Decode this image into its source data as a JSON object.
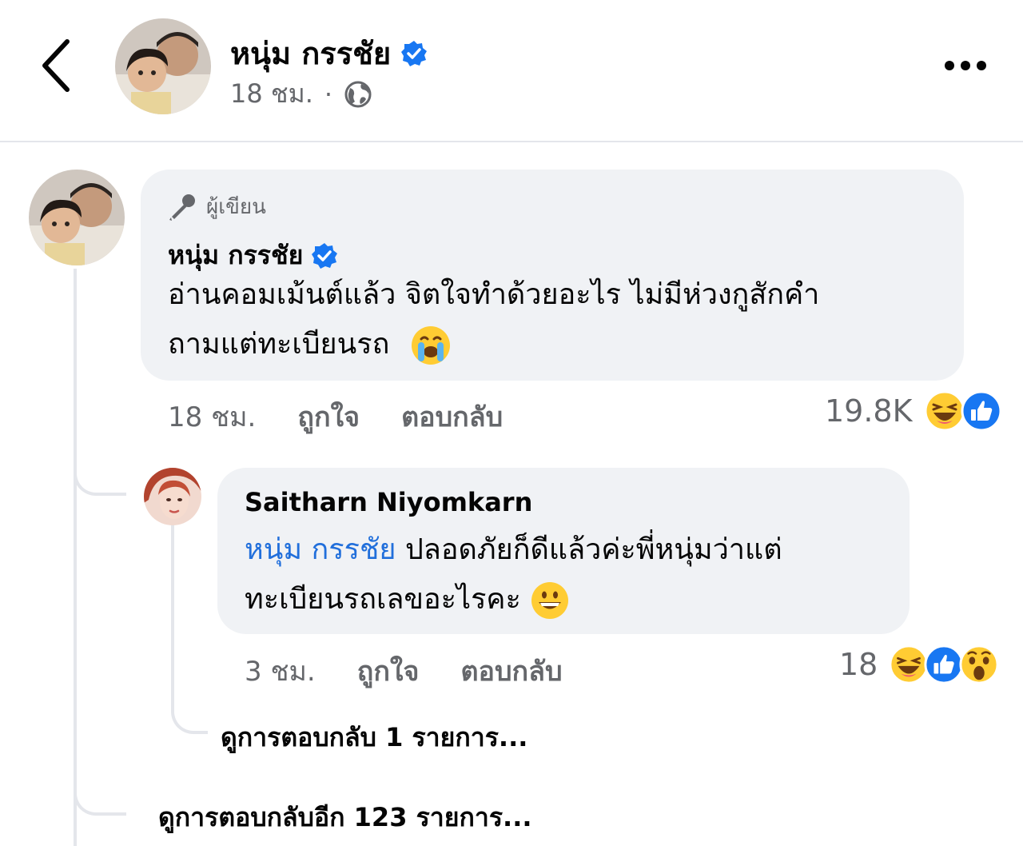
{
  "header": {
    "name": "หนุ่ม กรรชัย",
    "time": "18 ชม.",
    "separator": "·",
    "privacy_icon": "globe-icon",
    "back_icon": "chevron-left-icon",
    "more_icon": "more-horizontal-icon"
  },
  "main_comment": {
    "badge": "ผู้เขียน",
    "badge_icon": "microphone-icon",
    "author": "หนุ่ม กรรชัย",
    "verified": true,
    "text_line1": "อ่านคอมเม้นต์แล้ว จิตใจทำด้วยอะไร ไม่มีห่วงกูสักคำ",
    "text_line2": "ถามแต่ทะเบียนรถ",
    "emoji": "crying-face",
    "time": "18 ชม.",
    "like": "ถูกใจ",
    "reply": "ตอบกลับ",
    "reaction_count": "19.8K",
    "reactions": [
      "haha",
      "like"
    ]
  },
  "reply_comment": {
    "author": "Saitharn Niyomkarn",
    "mention": "หนุ่ม กรรชัย",
    "text_line1": " ปลอดภัยก็ดีแล้วค่ะพี่หนุ่มว่าแต่",
    "text_line2": "ทะเบียนรถเลขอะไรคะ",
    "emoji": "grinning-face",
    "time": "3 ชม.",
    "like": "ถูกใจ",
    "reply": "ตอบกลับ",
    "reaction_count": "18",
    "reactions": [
      "haha",
      "like",
      "wow"
    ]
  },
  "view_replies_nested": "ดูการตอบกลับ 1 รายการ...",
  "view_replies_more": "ดูการตอบกลับอีก 123 รายการ...",
  "colors": {
    "verified_blue": "#1877f2",
    "mention_blue": "#216fdb",
    "bubble_bg": "#f0f2f5",
    "muted_text": "#65676b"
  }
}
